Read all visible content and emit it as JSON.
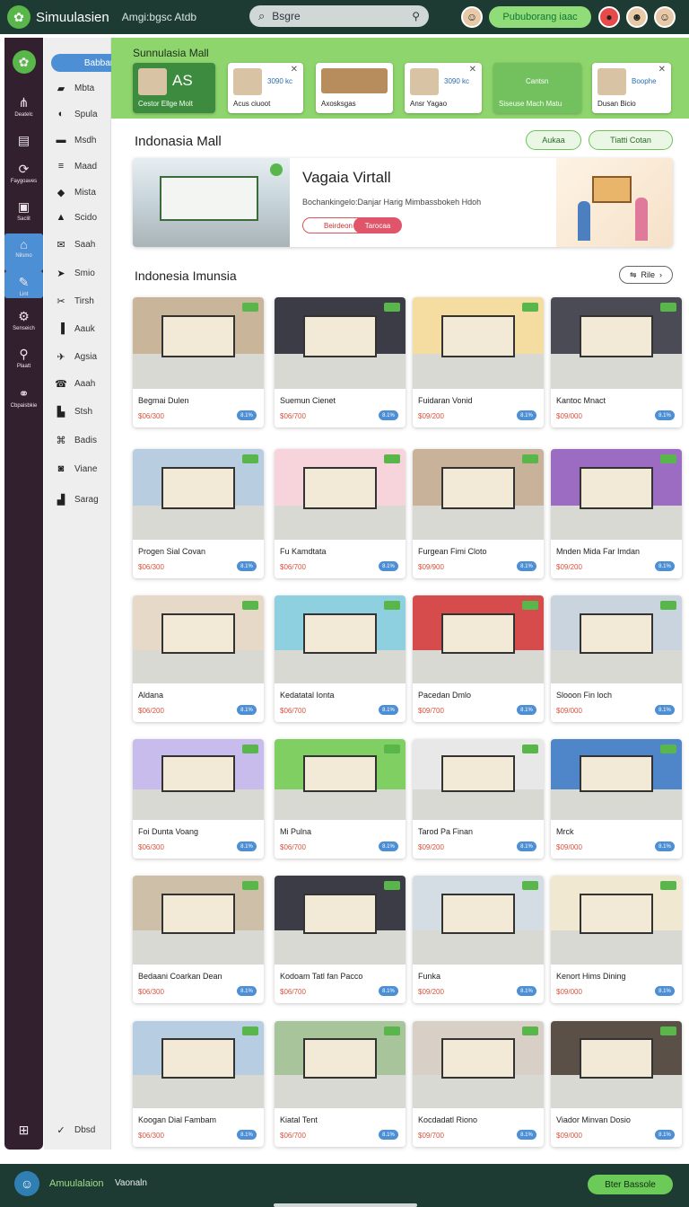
{
  "topbar": {
    "brand": "Simuulasien",
    "nav_text": "Amgi:bgsc Atdb",
    "search_placeholder": "Bsgre",
    "cta": "Pububorang iaac"
  },
  "rail": {
    "items": [
      {
        "icon": "⋔",
        "label": "Deatelc"
      },
      {
        "icon": "▤",
        "label": ""
      },
      {
        "icon": "⟳",
        "label": "Faygoaves"
      },
      {
        "icon": "▣",
        "label": "Saclit"
      },
      {
        "icon": "⌂",
        "label": "Nilsmo",
        "active": true
      },
      {
        "icon": "✎",
        "label": "Lint"
      },
      {
        "icon": "⚙",
        "label": "Senseich"
      },
      {
        "icon": "⚲",
        "label": "Plaatt"
      },
      {
        "icon": "⚭",
        "label": "Cbpaisbkie"
      }
    ],
    "bottom_icon": "⊞"
  },
  "subbar": {
    "active": "Babbar",
    "items": [
      {
        "icon": "▰",
        "label": "Mbta"
      },
      {
        "icon": "◐",
        "label": "Spula"
      },
      {
        "icon": "▬",
        "label": "Msdh"
      },
      {
        "icon": "≡",
        "label": "Maad"
      },
      {
        "icon": "◆",
        "label": "Mista"
      },
      {
        "icon": "▲",
        "label": "Scido"
      },
      {
        "icon": "✉",
        "label": "Saah"
      },
      {
        "icon": "➤",
        "label": "Smio"
      },
      {
        "icon": "✂",
        "label": "Tirsh"
      },
      {
        "icon": "▐",
        "label": "Aauk"
      },
      {
        "icon": "✈",
        "label": "Agsia"
      },
      {
        "icon": "☎",
        "label": "Aaah"
      },
      {
        "icon": "▙",
        "label": "Stsh"
      },
      {
        "icon": "⌘",
        "label": "Badis"
      },
      {
        "icon": "◙",
        "label": "Viane"
      },
      {
        "icon": "▟",
        "label": "Sarag"
      }
    ],
    "bottom_icon": "✓",
    "bottom_label": "Dbsd"
  },
  "mall_bar": {
    "title": "Sunnulasia Mall",
    "cards": [
      {
        "big": "AS",
        "label": "Cestor Ellge Molt",
        "dark": true
      },
      {
        "price": "3090 kc",
        "label": "Acus ciuoot"
      },
      {
        "label": "Axosksgas"
      },
      {
        "price": "3090 kc",
        "label": "Ansr Yagao"
      },
      {
        "price": "Cantsn",
        "label": "Siseuse Mach Matu",
        "dark": true
      },
      {
        "price": "Boophe",
        "label": "Dusan Bicio"
      }
    ]
  },
  "section1": {
    "title": "Indonasia Mall",
    "btn_a": "Aukaa",
    "btn_b": "Tiatti Cotan"
  },
  "hero": {
    "title": "Vagaia Virtall",
    "subtitle": "Bochankingelo:Danjar Harig Mimbassbokeh Hdoh",
    "btn1": "Beirdeon",
    "btn2": "Tarocaa"
  },
  "section2": {
    "title": "Indonesia Imunsia",
    "filter": "Rile"
  },
  "products": [
    {
      "name": "Begmai Dulen",
      "price": "$06/300",
      "badge": "8.1%",
      "bg": "#c9b59a"
    },
    {
      "name": "Suemun Cienet",
      "price": "$06/700",
      "badge": "8.1%",
      "bg": "#3c3c46"
    },
    {
      "name": "Fuidaran Vonid",
      "price": "$09/200",
      "badge": "8.1%",
      "bg": "#f5dca0"
    },
    {
      "name": "Kantoc Mnact",
      "price": "$09/000",
      "badge": "8.1%",
      "bg": "#4b4b55"
    },
    {
      "name": "Progen Sial Covan",
      "price": "$06/300",
      "badge": "8.1%",
      "bg": "#b8cde0"
    },
    {
      "name": "Fu Kamdtata",
      "price": "$06/700",
      "badge": "8.1%",
      "bg": "#f7d4dc"
    },
    {
      "name": "Furgean Fimi Cloto",
      "price": "$09/900",
      "badge": "8.1%",
      "bg": "#c8b29a"
    },
    {
      "name": "Mnden Mida Far Imdan",
      "price": "$09/200",
      "badge": "8.1%",
      "bg": "#9b6cc2"
    },
    {
      "name": "Aldana",
      "price": "$06/200",
      "badge": "8.1%",
      "bg": "#e6d9c7"
    },
    {
      "name": "Kedatatal Ionta",
      "price": "$06/700",
      "badge": "8.1%",
      "bg": "#8ecfe0"
    },
    {
      "name": "Pacedan Dmlo",
      "price": "$09/700",
      "badge": "8.1%",
      "bg": "#d64b4b"
    },
    {
      "name": "Slooon Fin loch",
      "price": "$09/000",
      "badge": "8.1%",
      "bg": "#c9d4de"
    },
    {
      "name": "Foi Dunta Voang",
      "price": "$06/300",
      "badge": "8.1%",
      "bg": "#c7bcec"
    },
    {
      "name": "Mi Pulna",
      "price": "$06/700",
      "badge": "8.1%",
      "bg": "#7fcf63"
    },
    {
      "name": "Tarod Pa Finan",
      "price": "$09/200",
      "badge": "8.1%",
      "bg": "#e8e8e8"
    },
    {
      "name": "Mrck",
      "price": "$09/000",
      "badge": "8.1%",
      "bg": "#4e86c9"
    },
    {
      "name": "Bedaani Coarkan Dean",
      "price": "$06/300",
      "badge": "8.1%",
      "bg": "#cdbfa8"
    },
    {
      "name": "Kodoam Tatl fan Pacco",
      "price": "$06/700",
      "badge": "8.1%",
      "bg": "#3c3c46"
    },
    {
      "name": "Funka",
      "price": "$09/200",
      "badge": "8.1%",
      "bg": "#d4dde4"
    },
    {
      "name": "Kenort Hims Dining",
      "price": "$09/000",
      "badge": "8.1%",
      "bg": "#f1e8d2"
    },
    {
      "name": "Koogan Dial Fambam",
      "price": "$06/300",
      "badge": "8.1%",
      "bg": "#b7cde2"
    },
    {
      "name": "Kiatal Tent",
      "price": "$06/700",
      "badge": "8.1%",
      "bg": "#a8c49a"
    },
    {
      "name": "Kocdadatl Riono",
      "price": "$09/700",
      "badge": "8.1%",
      "bg": "#d8d0c6"
    },
    {
      "name": "Viador Minvan Dosio",
      "price": "$09/000",
      "badge": "8.1%",
      "bg": "#5a5048"
    }
  ],
  "bottombar": {
    "brand": "Amuulalaion",
    "text": "Vaonaln",
    "cta": "Bter Bassole"
  }
}
